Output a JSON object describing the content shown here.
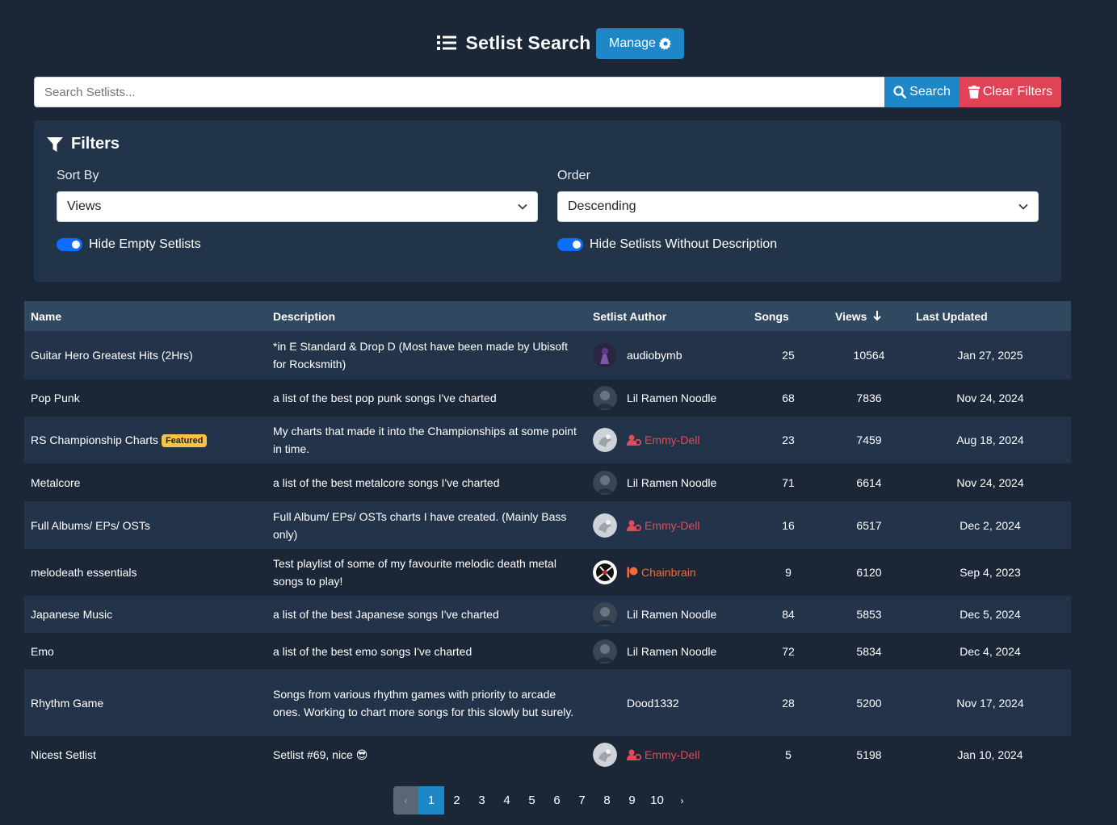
{
  "header": {
    "title": "Setlist Search",
    "manage_label": "Manage"
  },
  "search": {
    "placeholder": "Search Setlists...",
    "search_label": "Search",
    "clear_label": "Clear Filters"
  },
  "filters": {
    "title": "Filters",
    "sort_label": "Sort By",
    "sort_value": "Views",
    "order_label": "Order",
    "order_value": "Descending",
    "toggle1_label": "Hide Empty Setlists",
    "toggle1_on": true,
    "toggle2_label": "Hide Setlists Without Description",
    "toggle2_on": true
  },
  "table": {
    "headers": {
      "name": "Name",
      "description": "Description",
      "author": "Setlist Author",
      "songs": "Songs",
      "views": "Views",
      "updated": "Last Updated"
    },
    "rows": [
      {
        "name": "Guitar Hero Greatest Hits (2Hrs)",
        "description": "*in E Standard & Drop D (Most have been made by Ubisoft for Rocksmith)",
        "author": "audiobymb",
        "songs": "25",
        "views": "10564",
        "updated": "Jan 27, 2025"
      },
      {
        "name": "Pop Punk",
        "description": "a list of the best pop punk songs I've charted",
        "author": "Lil Ramen Noodle",
        "songs": "68",
        "views": "7836",
        "updated": "Nov 24, 2024"
      },
      {
        "name": "RS Championship Charts",
        "badge": "Featured",
        "description": "My charts that made it into the Championships at some point in time.",
        "author": "Emmy-Dell",
        "songs": "23",
        "views": "7459",
        "updated": "Aug 18, 2024"
      },
      {
        "name": "Metalcore",
        "description": "a list of the best metalcore songs I've charted",
        "author": "Lil Ramen Noodle",
        "songs": "71",
        "views": "6614",
        "updated": "Nov 24, 2024"
      },
      {
        "name": "Full Albums/ EPs/ OSTs",
        "description": "Full Album/ EPs/ OSTs charts I have created. (Mainly Bass only)",
        "author": "Emmy-Dell",
        "songs": "16",
        "views": "6517",
        "updated": "Dec 2, 2024"
      },
      {
        "name": "melodeath essentials",
        "description": "Test playlist of some of my favourite melodic death metal songs to play!",
        "author": "Chainbrain",
        "songs": "9",
        "views": "6120",
        "updated": "Sep 4, 2023"
      },
      {
        "name": "Japanese Music",
        "description": "a list of the best Japanese songs I've charted",
        "author": "Lil Ramen Noodle",
        "songs": "84",
        "views": "5853",
        "updated": "Dec 5, 2024"
      },
      {
        "name": "Emo",
        "description": "a list of the best emo songs I've charted",
        "author": "Lil Ramen Noodle",
        "songs": "72",
        "views": "5834",
        "updated": "Dec 4, 2024"
      },
      {
        "name": "Rhythm Game",
        "description": "Songs from various rhythm games with priority to arcade ones. Working to chart more songs for this slowly but surely.",
        "author": "Dood1332",
        "songs": "28",
        "views": "5200",
        "updated": "Nov 17, 2024"
      },
      {
        "name": "Nicest Setlist",
        "description": "Setlist #69, nice 😎",
        "author": "Emmy-Dell",
        "songs": "5",
        "views": "5198",
        "updated": "Jan 10, 2024"
      }
    ]
  },
  "pagination": {
    "prev": "‹",
    "pages": [
      "1",
      "2",
      "3",
      "4",
      "5",
      "6",
      "7",
      "8",
      "9",
      "10"
    ],
    "next": "›",
    "current": "1"
  },
  "colors": {
    "background": "#1b2636",
    "primary": "#1d87c7",
    "danger": "#e14356",
    "panel": "#22344a",
    "header_row": "#304860"
  }
}
